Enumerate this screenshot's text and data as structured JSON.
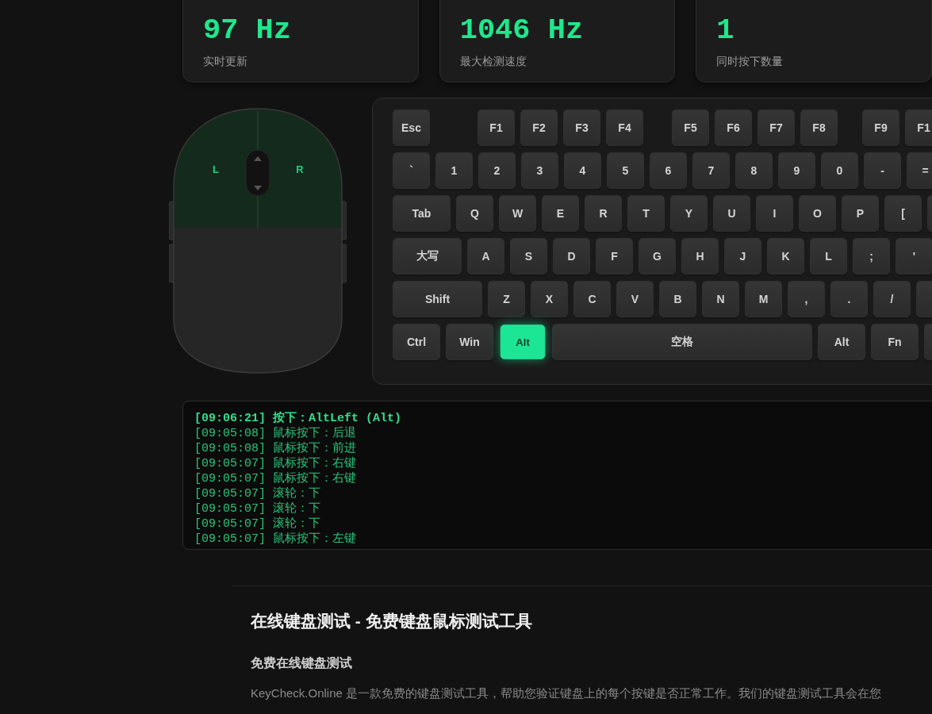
{
  "stats": [
    {
      "value": "97 Hz",
      "caption": "实时更新"
    },
    {
      "value": "1046 Hz",
      "caption": "最大检测速度"
    },
    {
      "value": "1",
      "caption": "同时按下数量"
    }
  ],
  "mouse": {
    "left_label": "L",
    "right_label": "R"
  },
  "keyboard": {
    "function_groups": [
      [
        {
          "label": "Esc",
          "pressed": false
        }
      ],
      [
        {
          "label": "F1",
          "pressed": false
        },
        {
          "label": "F2",
          "pressed": false
        },
        {
          "label": "F3",
          "pressed": false
        },
        {
          "label": "F4",
          "pressed": false
        }
      ],
      [
        {
          "label": "F5",
          "pressed": false
        },
        {
          "label": "F6",
          "pressed": false
        },
        {
          "label": "F7",
          "pressed": false
        },
        {
          "label": "F8",
          "pressed": false
        }
      ],
      [
        {
          "label": "F9",
          "pressed": false
        },
        {
          "label": "F1",
          "pressed": false
        }
      ]
    ],
    "rows": [
      {
        "keys": [
          {
            "label": "`",
            "pressed": false
          },
          {
            "label": "1",
            "pressed": false
          },
          {
            "label": "2",
            "pressed": false
          },
          {
            "label": "3",
            "pressed": false
          },
          {
            "label": "4",
            "pressed": false
          },
          {
            "label": "5",
            "pressed": false
          },
          {
            "label": "6",
            "pressed": false
          },
          {
            "label": "7",
            "pressed": false
          },
          {
            "label": "8",
            "pressed": false
          },
          {
            "label": "9",
            "pressed": false
          },
          {
            "label": "0",
            "pressed": false
          },
          {
            "label": "-",
            "pressed": false
          },
          {
            "label": "=",
            "pressed": false
          }
        ]
      },
      {
        "keys": [
          {
            "label": "Tab",
            "kind": "tab",
            "pressed": false
          },
          {
            "label": "Q",
            "pressed": false
          },
          {
            "label": "W",
            "pressed": false
          },
          {
            "label": "E",
            "pressed": false
          },
          {
            "label": "R",
            "pressed": false
          },
          {
            "label": "T",
            "pressed": false
          },
          {
            "label": "Y",
            "pressed": false
          },
          {
            "label": "U",
            "pressed": false
          },
          {
            "label": "I",
            "pressed": false
          },
          {
            "label": "O",
            "pressed": false
          },
          {
            "label": "P",
            "pressed": false
          },
          {
            "label": "[",
            "pressed": false
          },
          {
            "pressed": false
          }
        ]
      },
      {
        "keys": [
          {
            "label": "大写",
            "kind": "caps",
            "pressed": false
          },
          {
            "label": "A",
            "pressed": false
          },
          {
            "label": "S",
            "pressed": false
          },
          {
            "label": "D",
            "pressed": false
          },
          {
            "label": "F",
            "pressed": false
          },
          {
            "label": "G",
            "pressed": false
          },
          {
            "label": "H",
            "pressed": false
          },
          {
            "label": "J",
            "pressed": false
          },
          {
            "label": "K",
            "pressed": false
          },
          {
            "label": "L",
            "pressed": false
          },
          {
            "label": ";",
            "pressed": false
          },
          {
            "label": "'",
            "pressed": false
          }
        ]
      },
      {
        "keys": [
          {
            "label": "Shift",
            "kind": "shift",
            "pressed": false
          },
          {
            "label": "Z",
            "pressed": false
          },
          {
            "label": "X",
            "pressed": false
          },
          {
            "label": "C",
            "pressed": false
          },
          {
            "label": "V",
            "pressed": false
          },
          {
            "label": "B",
            "pressed": false
          },
          {
            "label": "N",
            "pressed": false
          },
          {
            "label": "M",
            "pressed": false
          },
          {
            "label": ",",
            "pressed": false
          },
          {
            "label": ".",
            "pressed": false
          },
          {
            "label": "/",
            "pressed": false
          },
          {
            "pressed": false
          }
        ]
      },
      {
        "keys": [
          {
            "label": "Ctrl",
            "kind": "mod",
            "pressed": false
          },
          {
            "label": "Win",
            "kind": "mod",
            "pressed": false
          },
          {
            "label": "Alt",
            "kind": "mod",
            "pressed": true
          },
          {
            "label": "空格",
            "kind": "space",
            "pressed": false
          },
          {
            "label": "Alt",
            "kind": "mod",
            "pressed": false
          },
          {
            "label": "Fn",
            "kind": "mod",
            "pressed": false
          },
          {
            "pressed": false
          }
        ]
      }
    ]
  },
  "log": [
    {
      "text": "[09:06:21] 按下：AltLeft (Alt)",
      "latest": true
    },
    {
      "text": "[09:05:08] 鼠标按下：后退",
      "latest": false
    },
    {
      "text": "[09:05:08] 鼠标按下：前进",
      "latest": false
    },
    {
      "text": "[09:05:07] 鼠标按下：右键",
      "latest": false
    },
    {
      "text": "[09:05:07] 鼠标按下：右键",
      "latest": false
    },
    {
      "text": "[09:05:07] 滚轮：下",
      "latest": false
    },
    {
      "text": "[09:05:07] 滚轮：下",
      "latest": false
    },
    {
      "text": "[09:05:07] 滚轮：下",
      "latest": false
    },
    {
      "text": "[09:05:07] 鼠标按下：左键",
      "latest": false
    }
  ],
  "article": {
    "title": "在线键盘测试 - 免费键盘鼠标测试工具",
    "subtitle": "免费在线键盘测试",
    "paragraph": "KeyCheck.Online 是一款免费的键盘测试工具，帮助您验证键盘上的每个按键是否正常工作。我们的键盘测试工具会在您"
  }
}
